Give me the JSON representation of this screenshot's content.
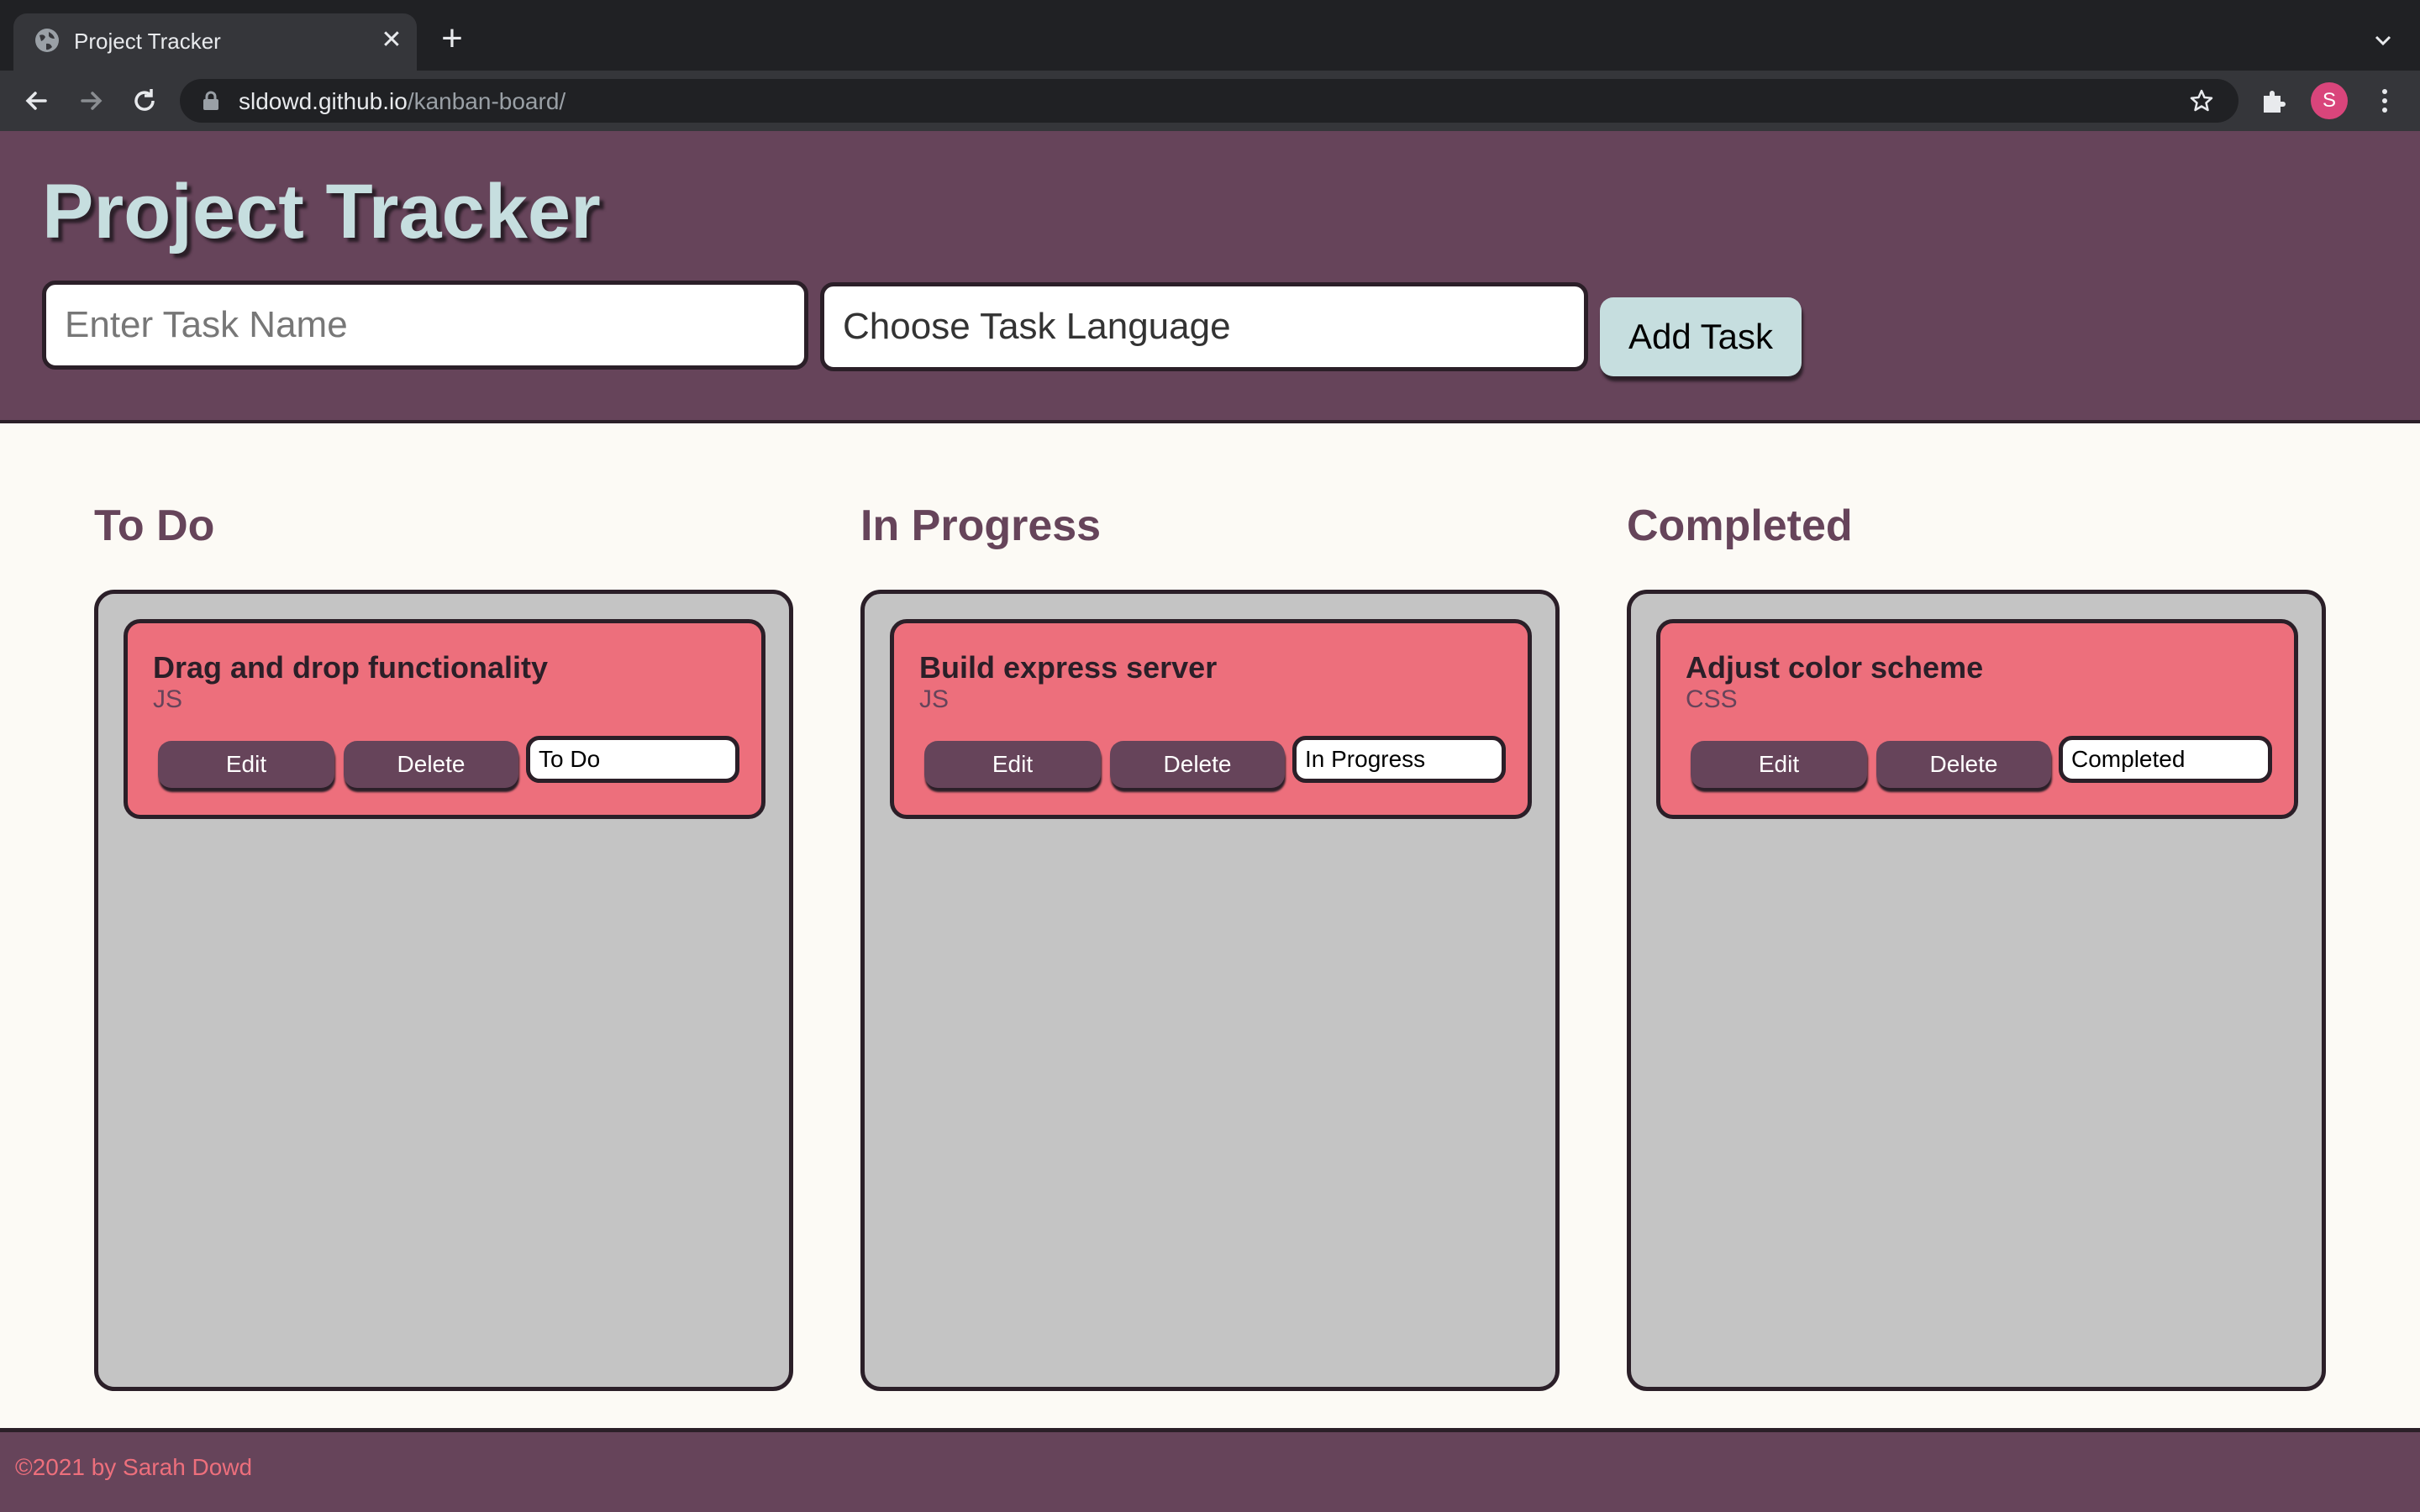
{
  "browser": {
    "tab_title": "Project Tracker",
    "tab_close": "✕",
    "new_tab": "+",
    "url_host": "sldowd.github.io",
    "url_path": "/kanban-board/",
    "profile_initial": "S"
  },
  "header": {
    "title": "Project Tracker",
    "task_name_placeholder": "Enter Task Name",
    "task_language_placeholder": "Choose Task Language",
    "add_button": "Add Task"
  },
  "columns": [
    {
      "title": "To Do",
      "cards": [
        {
          "title": "Drag and drop functionality",
          "language": "JS",
          "edit": "Edit",
          "delete": "Delete",
          "status": "To Do"
        }
      ]
    },
    {
      "title": "In Progress",
      "cards": [
        {
          "title": "Build express server",
          "language": "JS",
          "edit": "Edit",
          "delete": "Delete",
          "status": "In Progress"
        }
      ]
    },
    {
      "title": "Completed",
      "cards": [
        {
          "title": "Adjust color scheme",
          "language": "CSS",
          "edit": "Edit",
          "delete": "Delete",
          "status": "Completed"
        }
      ]
    }
  ],
  "footer": {
    "text": "©2021 by Sarah Dowd"
  },
  "colors": {
    "primary": "#66445a",
    "accent": "#c6dedf",
    "card": "#ed6f7c",
    "lane": "#c4c4c4",
    "page_background": "#fcfaf5",
    "dark": "#2b1f28"
  },
  "icons": [
    "globe-icon",
    "close-icon",
    "plus-icon",
    "chevron-down-icon",
    "back-icon",
    "forward-icon",
    "reload-icon",
    "lock-icon",
    "star-icon",
    "puzzle-icon",
    "menu-icon"
  ]
}
